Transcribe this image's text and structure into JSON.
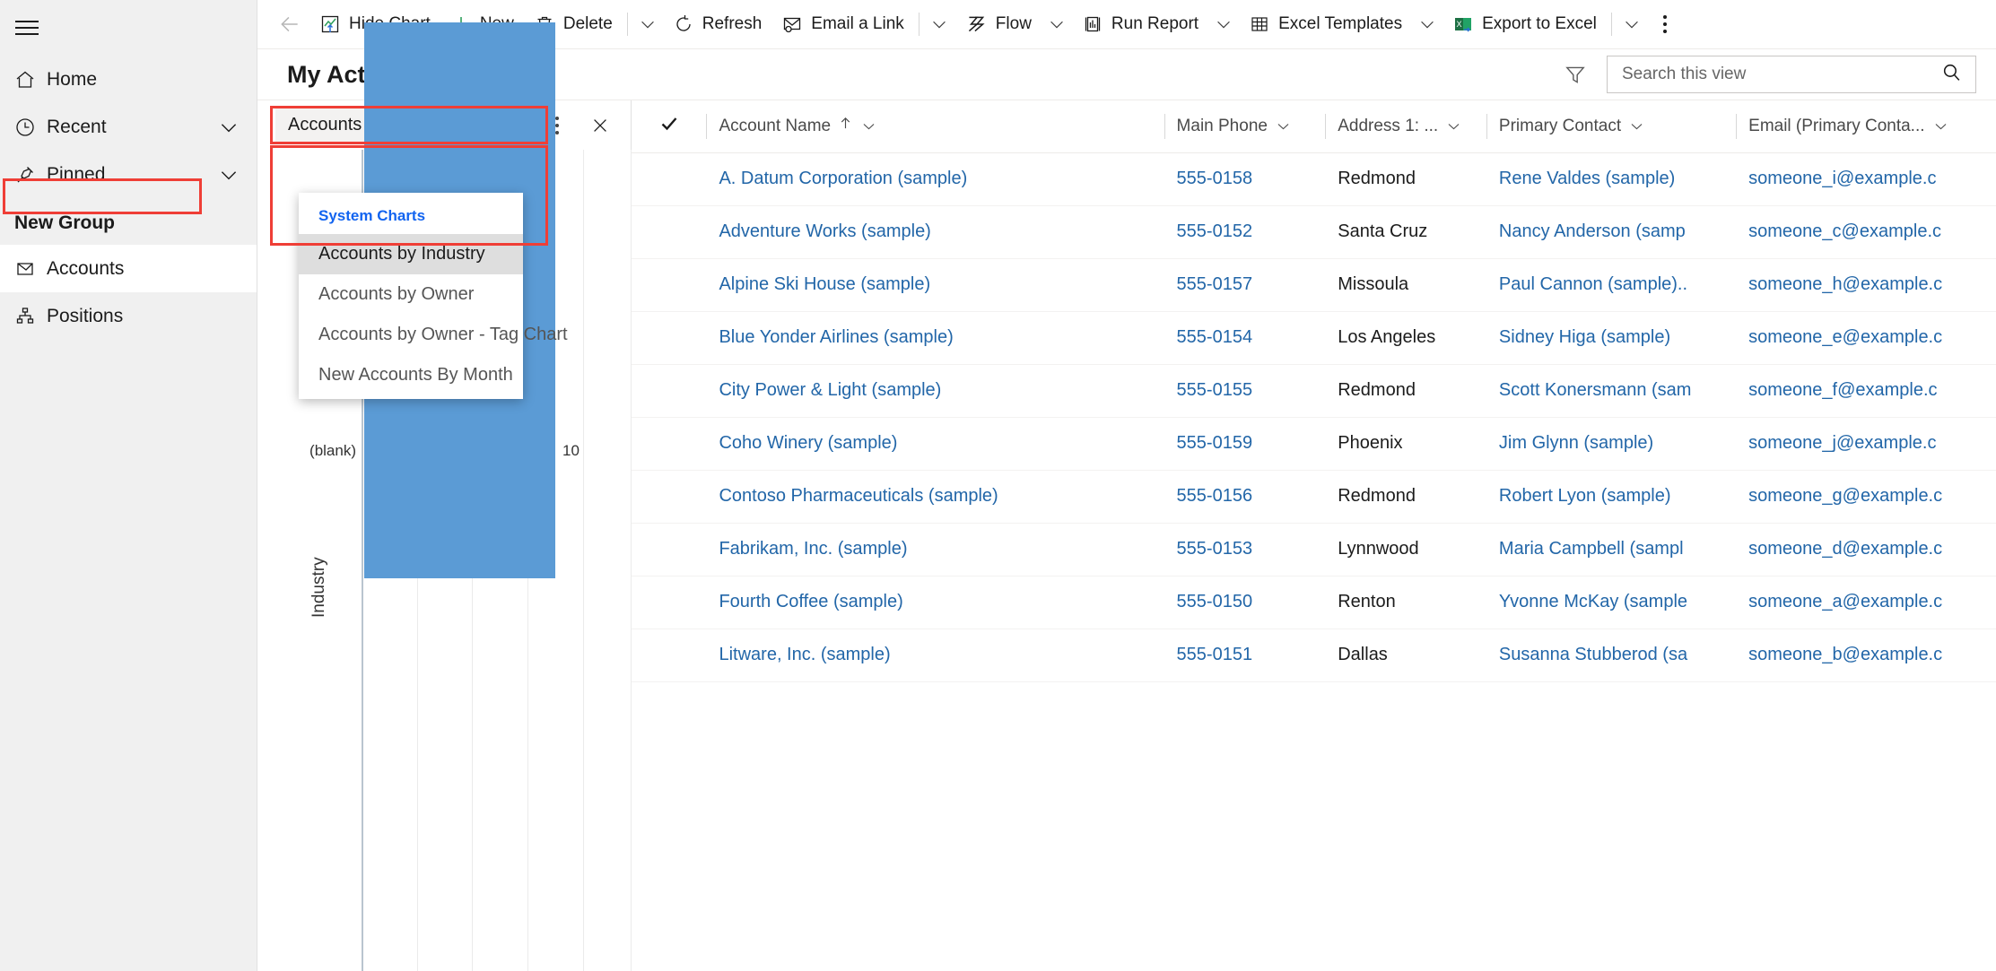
{
  "sidebar": {
    "hamburger": "site-map-toggle",
    "items": [
      {
        "label": "Home",
        "icon": "home-icon",
        "chevron": false
      },
      {
        "label": "Recent",
        "icon": "clock-icon",
        "chevron": true
      },
      {
        "label": "Pinned",
        "icon": "pin-icon",
        "chevron": true
      }
    ],
    "group_title": "New Group",
    "group_items": [
      {
        "label": "Accounts",
        "icon": "accounts-icon",
        "selected": true
      },
      {
        "label": "Positions",
        "icon": "positions-icon",
        "selected": false
      }
    ]
  },
  "commandbar": {
    "back": "back-arrow",
    "items": [
      {
        "label": "Hide Chart",
        "icon": "chart-icon",
        "split": false,
        "highlighted": true
      },
      {
        "label": "New",
        "icon": "plus-icon",
        "split": false
      },
      {
        "label": "Delete",
        "icon": "trash-icon",
        "split": true
      },
      {
        "label": "Refresh",
        "icon": "refresh-icon",
        "split": false
      },
      {
        "label": "Email a Link",
        "icon": "email-link-icon",
        "split": true
      },
      {
        "label": "Flow",
        "icon": "flow-icon",
        "split": true
      },
      {
        "label": "Run Report",
        "icon": "report-icon",
        "split": true
      },
      {
        "label": "Excel Templates",
        "icon": "excel-template-icon",
        "split": true
      },
      {
        "label": "Export to Excel",
        "icon": "excel-export-icon",
        "split": true
      }
    ],
    "overflow": "more-commands"
  },
  "view": {
    "title": "My Active Accounts",
    "filter_icon": "filter-icon",
    "search": {
      "placeholder": "Search this view",
      "value": "",
      "icon": "search-icon"
    }
  },
  "chart_panel": {
    "selector_label": "Accounts by Industry",
    "kebab": "chart-more-commands",
    "close": "close-chart",
    "menu": {
      "header": "System Charts",
      "items": [
        {
          "label": "Accounts by Industry",
          "selected": true
        },
        {
          "label": "Accounts by Owner",
          "selected": false
        },
        {
          "label": "Accounts by Owner - Tag Chart",
          "selected": false
        },
        {
          "label": "New Accounts By Month",
          "selected": false
        }
      ]
    }
  },
  "chart_data": {
    "type": "bar",
    "orientation": "horizontal",
    "title": "Accounts by Industry",
    "categories": [
      "(blank)"
    ],
    "values": [
      10
    ],
    "data_labels": [
      "10"
    ],
    "xlabel": "",
    "ylabel": "Industry",
    "grid": true,
    "legend": "none",
    "series_color": "#5b9bd5"
  },
  "grid": {
    "select_all_icon": "checkmark-icon",
    "columns": [
      {
        "label": "Account Name",
        "sort": "ascending",
        "chevron": true
      },
      {
        "label": "Main Phone",
        "sort": "",
        "chevron": true
      },
      {
        "label": "Address 1: ...",
        "sort": "",
        "chevron": true
      },
      {
        "label": "Primary Contact",
        "sort": "",
        "chevron": true
      },
      {
        "label": "Email (Primary Conta...",
        "sort": "",
        "chevron": true
      }
    ],
    "rows": [
      {
        "name": "A. Datum Corporation (sample)",
        "phone": "555-0158",
        "address": "Redmond",
        "contact": "Rene Valdes (sample)",
        "email": "someone_i@example.c"
      },
      {
        "name": "Adventure Works (sample)",
        "phone": "555-0152",
        "address": "Santa Cruz",
        "contact": "Nancy Anderson (samp",
        "email": "someone_c@example.c"
      },
      {
        "name": "Alpine Ski House (sample)",
        "phone": "555-0157",
        "address": "Missoula",
        "contact": "Paul Cannon (sample)..",
        "email": "someone_h@example.c"
      },
      {
        "name": "Blue Yonder Airlines (sample)",
        "phone": "555-0154",
        "address": "Los Angeles",
        "contact": "Sidney Higa (sample)",
        "email": "someone_e@example.c"
      },
      {
        "name": "City Power & Light (sample)",
        "phone": "555-0155",
        "address": "Redmond",
        "contact": "Scott Konersmann (sam",
        "email": "someone_f@example.c"
      },
      {
        "name": "Coho Winery (sample)",
        "phone": "555-0159",
        "address": "Phoenix",
        "contact": "Jim Glynn (sample)",
        "email": "someone_j@example.c"
      },
      {
        "name": "Contoso Pharmaceuticals (sample)",
        "phone": "555-0156",
        "address": "Redmond",
        "contact": "Robert Lyon (sample)",
        "email": "someone_g@example.c"
      },
      {
        "name": "Fabrikam, Inc. (sample)",
        "phone": "555-0153",
        "address": "Lynnwood",
        "contact": "Maria Campbell (sampl",
        "email": "someone_d@example.c"
      },
      {
        "name": "Fourth Coffee (sample)",
        "phone": "555-0150",
        "address": "Renton",
        "contact": "Yvonne McKay (sample",
        "email": "someone_a@example.c"
      },
      {
        "name": "Litware, Inc. (sample)",
        "phone": "555-0151",
        "address": "Dallas",
        "contact": "Susanna Stubberod (sa",
        "email": "someone_b@example.c"
      }
    ]
  },
  "colors": {
    "link": "#2266a8",
    "bar": "#5b9bd5",
    "menu_header": "#1264f0",
    "highlight_box": "#ef3e36"
  }
}
